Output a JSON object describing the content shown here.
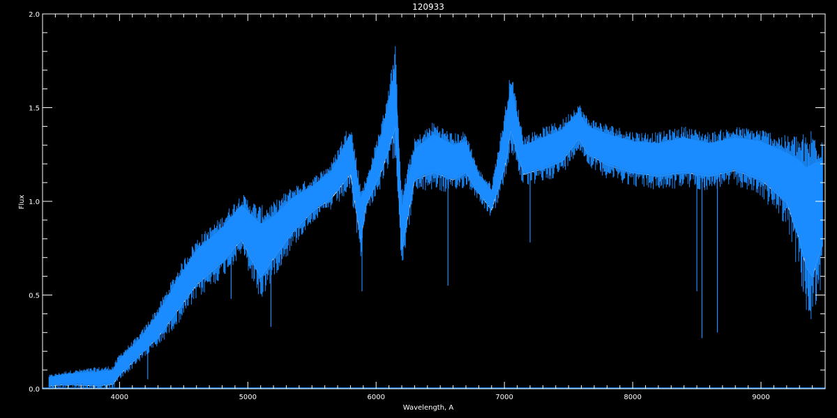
{
  "chart_data": {
    "type": "line",
    "title": "120933",
    "xlabel": "Wavelength, A",
    "ylabel": "Flux",
    "xlim": [
      3400,
      9500
    ],
    "ylim": [
      0.0,
      2.0
    ],
    "xticks": [
      4000,
      5000,
      6000,
      7000,
      8000,
      9000
    ],
    "xtick_labels": [
      "4000",
      "5000",
      "6000",
      "7000",
      "8000",
      "9000"
    ],
    "yticks": [
      0.0,
      0.5,
      1.0,
      1.5,
      2.0
    ],
    "ytick_labels": [
      "0.0",
      "0.5",
      "1.0",
      "1.5",
      "2.0"
    ],
    "grid": false,
    "background": "#000000",
    "axis_color": "#ffffff",
    "series": [
      {
        "color": "#1a8cff",
        "style": "envelope",
        "x": [
          3450,
          3600,
          3800,
          3950,
          4000,
          4150,
          4300,
          4450,
          4600,
          4800,
          4950,
          5100,
          5200,
          5350,
          5500,
          5650,
          5800,
          5880,
          5920,
          6050,
          6150,
          6200,
          6300,
          6450,
          6600,
          6700,
          6800,
          6900,
          7000,
          7050,
          7150,
          7300,
          7450,
          7580,
          7650,
          7800,
          8000,
          8200,
          8400,
          8600,
          8800,
          9000,
          9200,
          9300,
          9350,
          9400,
          9480
        ],
        "upper": [
          0.06,
          0.08,
          0.09,
          0.1,
          0.16,
          0.26,
          0.4,
          0.58,
          0.74,
          0.86,
          0.98,
          0.88,
          0.92,
          1.02,
          1.08,
          1.16,
          1.36,
          1.02,
          1.08,
          1.38,
          1.72,
          0.98,
          1.28,
          1.36,
          1.3,
          1.32,
          1.14,
          1.06,
          1.4,
          1.62,
          1.3,
          1.34,
          1.38,
          1.48,
          1.4,
          1.36,
          1.32,
          1.31,
          1.34,
          1.31,
          1.34,
          1.32,
          1.26,
          1.22,
          1.18,
          1.2,
          1.22
        ],
        "lower": [
          0.02,
          0.03,
          0.02,
          0.03,
          0.08,
          0.18,
          0.28,
          0.42,
          0.56,
          0.68,
          0.8,
          0.6,
          0.7,
          0.84,
          0.95,
          1.02,
          1.15,
          0.8,
          0.98,
          1.18,
          1.4,
          0.75,
          1.12,
          1.16,
          1.12,
          1.16,
          1.05,
          0.96,
          1.18,
          1.38,
          1.15,
          1.18,
          1.22,
          1.34,
          1.26,
          1.2,
          1.16,
          1.14,
          1.16,
          1.14,
          1.17,
          1.12,
          1.0,
          0.8,
          0.66,
          0.6,
          0.78
        ]
      },
      {
        "color": "#1a8cff",
        "style": "absorption-lines",
        "x": [
          4220,
          4870,
          5180,
          5890,
          6560,
          6870,
          7200,
          8500,
          8540,
          8660,
          9330
        ],
        "y": [
          0.05,
          0.48,
          0.33,
          0.52,
          0.55,
          0.95,
          0.78,
          0.52,
          0.27,
          0.3,
          0.53
        ]
      },
      {
        "color": "#1a8cff",
        "style": "baseline",
        "x": [
          3400,
          9500
        ],
        "y": [
          0.0,
          0.0
        ]
      }
    ]
  }
}
